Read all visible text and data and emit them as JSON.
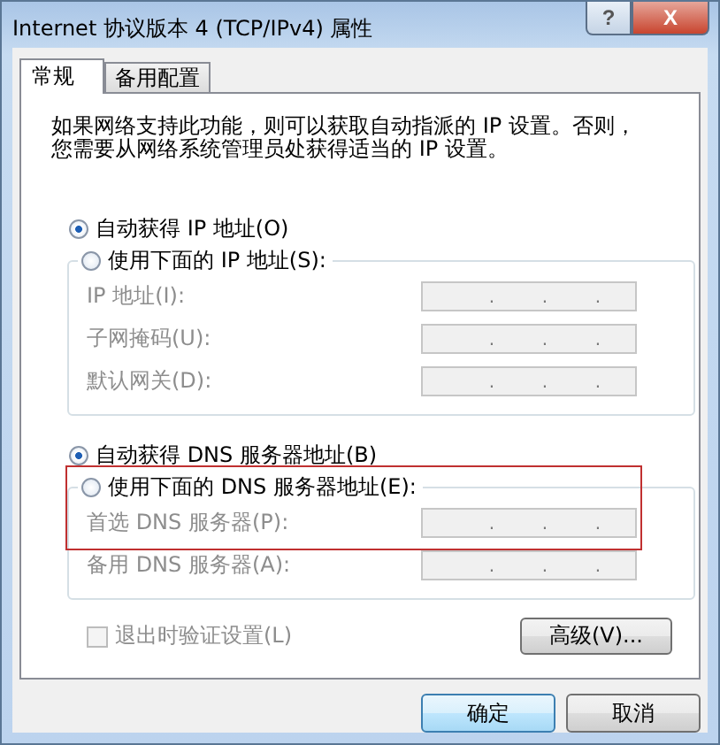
{
  "window": {
    "title": "Internet 协议版本 4 (TCP/IPv4) 属性",
    "help_button": "?",
    "close_button": "X"
  },
  "tabs": [
    {
      "label": "常规",
      "selected": true
    },
    {
      "label": "备用配置",
      "selected": false
    }
  ],
  "description": "如果网络支持此功能，则可以获取自动指派的 IP 设置。否则，您需要从网络系统管理员处获得适当的 IP 设置。",
  "ip_section": {
    "auto_option": {
      "label": "自动获得 IP 地址(O)",
      "selected": true
    },
    "manual_option": {
      "label": "使用下面的 IP 地址(S):",
      "selected": false
    },
    "fields": [
      {
        "label": "IP 地址(I):",
        "disabled": true,
        "separators": [
          ".",
          ".",
          "."
        ]
      },
      {
        "label": "子网掩码(U):",
        "disabled": true,
        "separators": [
          ".",
          ".",
          "."
        ]
      },
      {
        "label": "默认网关(D):",
        "disabled": true,
        "separators": [
          ".",
          ".",
          "."
        ]
      }
    ]
  },
  "dns_section": {
    "auto_option": {
      "label": "自动获得 DNS 服务器地址(B)",
      "selected": true
    },
    "manual_option": {
      "label": "使用下面的 DNS 服务器地址(E):",
      "selected": false,
      "highlighted": true
    },
    "fields": [
      {
        "label": "首选 DNS 服务器(P):",
        "disabled": true,
        "separators": [
          ".",
          ".",
          "."
        ]
      },
      {
        "label": "备用 DNS 服务器(A):",
        "disabled": true,
        "separators": [
          ".",
          ".",
          "."
        ]
      }
    ]
  },
  "validate_checkbox": {
    "label": "退出时验证设置(L)",
    "checked": false,
    "disabled": true
  },
  "advanced_button": "高级(V)...",
  "buttons": [
    {
      "label": "确定",
      "kind": "default"
    },
    {
      "label": "取消",
      "kind": "normal"
    }
  ]
}
